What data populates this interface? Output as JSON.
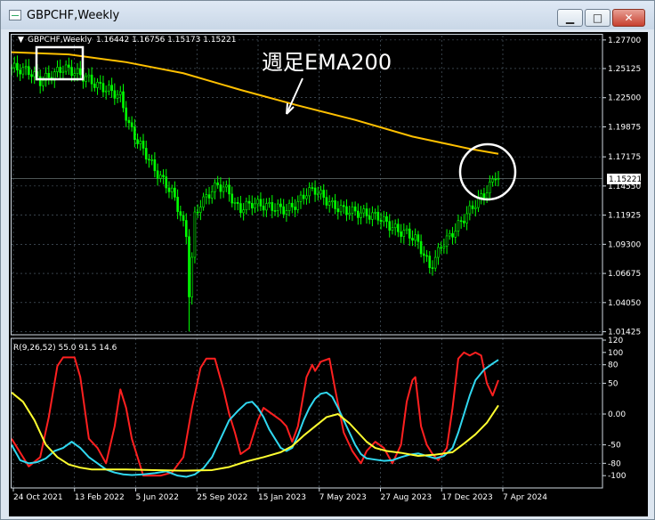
{
  "window": {
    "title": "GBPCHF,Weekly",
    "min_glyph": "▁",
    "max_glyph": "□",
    "close_glyph": "✕"
  },
  "colors": {
    "background": "#000000",
    "candles": "#00ff00",
    "ema": "#ffc000",
    "annotation": "#ffffff",
    "rci_fast": "#ff2020",
    "rci_mid": "#30d8f0",
    "rci_slow": "#ffff30",
    "grid": "#5a6a78",
    "text": "#ffffff"
  },
  "chart_data": [
    {
      "type": "candlestick",
      "header": {
        "symbol_label": "GBPCHF,Weekly",
        "ohlc_text": "1.16442 1.16756 1.15173 1.15221"
      },
      "current_price": "1.15221",
      "price_axis_ticks": [
        "1.27700",
        "1.25125",
        "1.22500",
        "1.19875",
        "1.17175",
        "1.14550",
        "1.11925",
        "1.09300",
        "1.06675",
        "1.04050",
        "1.01425"
      ],
      "ylim": [
        1.0115,
        1.2809
      ],
      "ema_label": "週足EMA200",
      "x_tick_labels": [
        "24 Oct 2021",
        "13 Feb 2022",
        "5 Jun 2022",
        "25 Sep 2022",
        "15 Jan 2023",
        "7 May 2023",
        "27 Aug 2023",
        "17 Dec 2023",
        "7 Apr 2024"
      ],
      "ema_series": [
        [
          0,
          1.266
        ],
        [
          20,
          1.264
        ],
        [
          40,
          1.257
        ],
        [
          60,
          1.247
        ],
        [
          80,
          1.232
        ],
        [
          100,
          1.218
        ],
        [
          120,
          1.205
        ],
        [
          140,
          1.19
        ],
        [
          160,
          1.179
        ],
        [
          170,
          1.1745
        ]
      ],
      "close_path": [
        [
          0,
          1.252
        ],
        [
          6,
          1.249
        ],
        [
          10,
          1.24
        ],
        [
          14,
          1.245
        ],
        [
          18,
          1.252
        ],
        [
          22,
          1.248
        ],
        [
          26,
          1.243
        ],
        [
          30,
          1.236
        ],
        [
          34,
          1.232
        ],
        [
          38,
          1.226
        ],
        [
          41,
          1.2
        ],
        [
          44,
          1.186
        ],
        [
          47,
          1.174
        ],
        [
          50,
          1.16
        ],
        [
          53,
          1.15
        ],
        [
          56,
          1.14
        ],
        [
          59,
          1.12
        ],
        [
          61,
          1.1
        ],
        [
          62,
          1.05
        ],
        [
          63,
          1.08
        ],
        [
          64,
          1.118
        ],
        [
          66,
          1.13
        ],
        [
          68,
          1.135
        ],
        [
          70,
          1.142
        ],
        [
          72,
          1.146
        ],
        [
          74,
          1.144
        ],
        [
          76,
          1.14
        ],
        [
          78,
          1.128
        ],
        [
          80,
          1.125
        ],
        [
          84,
          1.13
        ],
        [
          88,
          1.128
        ],
        [
          92,
          1.126
        ],
        [
          96,
          1.124
        ],
        [
          100,
          1.13
        ],
        [
          103,
          1.14
        ],
        [
          106,
          1.142
        ],
        [
          109,
          1.135
        ],
        [
          112,
          1.128
        ],
        [
          116,
          1.124
        ],
        [
          120,
          1.122
        ],
        [
          124,
          1.12
        ],
        [
          128,
          1.118
        ],
        [
          132,
          1.11
        ],
        [
          135,
          1.105
        ],
        [
          138,
          1.103
        ],
        [
          141,
          1.098
        ],
        [
          144,
          1.084
        ],
        [
          146,
          1.072
        ],
        [
          148,
          1.08
        ],
        [
          150,
          1.092
        ],
        [
          153,
          1.1
        ],
        [
          156,
          1.11
        ],
        [
          159,
          1.12
        ],
        [
          162,
          1.13
        ],
        [
          165,
          1.138
        ],
        [
          167,
          1.145
        ],
        [
          169,
          1.156
        ],
        [
          170,
          1.1522
        ]
      ]
    },
    {
      "type": "line",
      "header_text": "R(9,26,52) 55.0 91.5 14.6",
      "y_ticks": [
        "120",
        "100",
        "80",
        "50",
        "0.00",
        "-50",
        "-80",
        "-100"
      ],
      "ylim": [
        -120,
        120
      ],
      "series": [
        {
          "name": "9",
          "points": [
            [
              0,
              -40
            ],
            [
              6,
              -85
            ],
            [
              10,
              -70
            ],
            [
              13,
              -5
            ],
            [
              16,
              78
            ],
            [
              18,
              92
            ],
            [
              22,
              92
            ],
            [
              24,
              60
            ],
            [
              27,
              -40
            ],
            [
              30,
              -55
            ],
            [
              33,
              -80
            ],
            [
              36,
              -20
            ],
            [
              38,
              40
            ],
            [
              40,
              10
            ],
            [
              42,
              -40
            ],
            [
              44,
              -70
            ],
            [
              46,
              -100
            ],
            [
              48,
              -100
            ],
            [
              52,
              -100
            ],
            [
              56,
              -95
            ],
            [
              60,
              -70
            ],
            [
              63,
              10
            ],
            [
              66,
              75
            ],
            [
              68,
              90
            ],
            [
              71,
              90
            ],
            [
              74,
              40
            ],
            [
              76,
              0
            ],
            [
              78,
              -30
            ],
            [
              80,
              -65
            ],
            [
              83,
              -55
            ],
            [
              86,
              -10
            ],
            [
              88,
              10
            ],
            [
              91,
              0
            ],
            [
              94,
              -10
            ],
            [
              96,
              -20
            ],
            [
              98,
              -45
            ],
            [
              100,
              -20
            ],
            [
              103,
              60
            ],
            [
              105,
              80
            ],
            [
              106,
              70
            ],
            [
              108,
              85
            ],
            [
              111,
              90
            ],
            [
              113,
              40
            ],
            [
              116,
              -30
            ],
            [
              119,
              -60
            ],
            [
              122,
              -80
            ],
            [
              124,
              -60
            ],
            [
              127,
              -45
            ],
            [
              130,
              -55
            ],
            [
              133,
              -80
            ],
            [
              136,
              -50
            ],
            [
              138,
              20
            ],
            [
              140,
              55
            ],
            [
              141,
              60
            ],
            [
              143,
              -20
            ],
            [
              145,
              -50
            ],
            [
              147,
              -65
            ],
            [
              149,
              -75
            ],
            [
              152,
              -55
            ],
            [
              154,
              10
            ],
            [
              156,
              90
            ],
            [
              158,
              100
            ],
            [
              160,
              95
            ],
            [
              162,
              100
            ],
            [
              164,
              95
            ],
            [
              166,
              50
            ],
            [
              168,
              30
            ],
            [
              170,
              55
            ]
          ]
        },
        {
          "name": "26",
          "points": [
            [
              0,
              -50
            ],
            [
              3,
              -75
            ],
            [
              6,
              -80
            ],
            [
              9,
              -78
            ],
            [
              12,
              -72
            ],
            [
              15,
              -60
            ],
            [
              18,
              -55
            ],
            [
              21,
              -45
            ],
            [
              24,
              -55
            ],
            [
              27,
              -70
            ],
            [
              30,
              -80
            ],
            [
              33,
              -90
            ],
            [
              36,
              -95
            ],
            [
              39,
              -98
            ],
            [
              42,
              -99
            ],
            [
              46,
              -98
            ],
            [
              50,
              -96
            ],
            [
              54,
              -93
            ],
            [
              58,
              -100
            ],
            [
              61,
              -102
            ],
            [
              64,
              -98
            ],
            [
              67,
              -88
            ],
            [
              70,
              -70
            ],
            [
              73,
              -40
            ],
            [
              76,
              -10
            ],
            [
              79,
              5
            ],
            [
              82,
              18
            ],
            [
              84,
              20
            ],
            [
              86,
              10
            ],
            [
              88,
              -5
            ],
            [
              90,
              -25
            ],
            [
              92,
              -40
            ],
            [
              94,
              -55
            ],
            [
              96,
              -60
            ],
            [
              98,
              -55
            ],
            [
              100,
              -35
            ],
            [
              102,
              -10
            ],
            [
              104,
              10
            ],
            [
              106,
              25
            ],
            [
              108,
              33
            ],
            [
              110,
              35
            ],
            [
              112,
              28
            ],
            [
              114,
              10
            ],
            [
              116,
              -10
            ],
            [
              118,
              -30
            ],
            [
              120,
              -50
            ],
            [
              122,
              -65
            ],
            [
              124,
              -72
            ],
            [
              127,
              -74
            ],
            [
              130,
              -76
            ],
            [
              133,
              -75
            ],
            [
              136,
              -70
            ],
            [
              139,
              -66
            ],
            [
              142,
              -64
            ],
            [
              145,
              -68
            ],
            [
              148,
              -72
            ],
            [
              151,
              -68
            ],
            [
              154,
              -55
            ],
            [
              156,
              -30
            ],
            [
              158,
              0
            ],
            [
              160,
              30
            ],
            [
              162,
              55
            ],
            [
              165,
              72
            ],
            [
              168,
              82
            ],
            [
              170,
              88
            ]
          ]
        },
        {
          "name": "52",
          "points": [
            [
              0,
              35
            ],
            [
              4,
              20
            ],
            [
              8,
              -10
            ],
            [
              12,
              -50
            ],
            [
              16,
              -70
            ],
            [
              20,
              -82
            ],
            [
              24,
              -87
            ],
            [
              28,
              -90
            ],
            [
              32,
              -90
            ],
            [
              40,
              -90
            ],
            [
              50,
              -91
            ],
            [
              60,
              -92
            ],
            [
              70,
              -91
            ],
            [
              76,
              -86
            ],
            [
              82,
              -77
            ],
            [
              88,
              -70
            ],
            [
              94,
              -62
            ],
            [
              98,
              -52
            ],
            [
              102,
              -35
            ],
            [
              106,
              -20
            ],
            [
              110,
              -5
            ],
            [
              114,
              0
            ],
            [
              118,
              -15
            ],
            [
              121,
              -30
            ],
            [
              124,
              -45
            ],
            [
              127,
              -55
            ],
            [
              131,
              -60
            ],
            [
              136,
              -63
            ],
            [
              142,
              -68
            ],
            [
              148,
              -66
            ],
            [
              154,
              -62
            ],
            [
              158,
              -48
            ],
            [
              162,
              -33
            ],
            [
              166,
              -14
            ],
            [
              170,
              14
            ]
          ]
        }
      ]
    }
  ]
}
